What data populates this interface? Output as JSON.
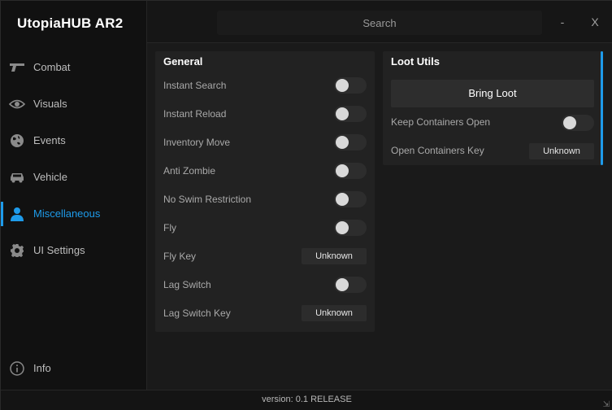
{
  "app": {
    "title": "UtopiaHUB AR2",
    "version": "version: 0.1 RELEASE"
  },
  "accent_color": "#1e9bea",
  "topbar": {
    "search_placeholder": "Search",
    "minimize": "-",
    "close": "X"
  },
  "sidebar": {
    "items": [
      {
        "label": "Combat",
        "icon": "gun-icon",
        "active": false
      },
      {
        "label": "Visuals",
        "icon": "eye-icon",
        "active": false
      },
      {
        "label": "Events",
        "icon": "globe-icon",
        "active": false
      },
      {
        "label": "Vehicle",
        "icon": "car-icon",
        "active": false
      },
      {
        "label": "Miscellaneous",
        "icon": "user-icon",
        "active": true
      },
      {
        "label": "UI Settings",
        "icon": "gear-icon",
        "active": false
      }
    ],
    "info": {
      "label": "Info",
      "icon": "info-icon"
    }
  },
  "general": {
    "title": "General",
    "rows": [
      {
        "label": "Instant Search",
        "type": "toggle",
        "on": false
      },
      {
        "label": "Instant Reload",
        "type": "toggle",
        "on": false
      },
      {
        "label": "Inventory Move",
        "type": "toggle",
        "on": false
      },
      {
        "label": "Anti Zombie",
        "type": "toggle",
        "on": false
      },
      {
        "label": "No Swim Restriction",
        "type": "toggle",
        "on": false
      },
      {
        "label": "Fly",
        "type": "toggle",
        "on": false
      },
      {
        "label": "Fly Key",
        "type": "key",
        "value": "Unknown"
      },
      {
        "label": "Lag Switch",
        "type": "toggle",
        "on": false
      },
      {
        "label": "Lag Switch Key",
        "type": "key",
        "value": "Unknown"
      }
    ]
  },
  "loot": {
    "title": "Loot Utils",
    "button": "Bring Loot",
    "rows": [
      {
        "label": "Keep Containers Open",
        "type": "toggle",
        "on": false
      },
      {
        "label": "Open Containers Key",
        "type": "key",
        "value": "Unknown"
      }
    ]
  }
}
